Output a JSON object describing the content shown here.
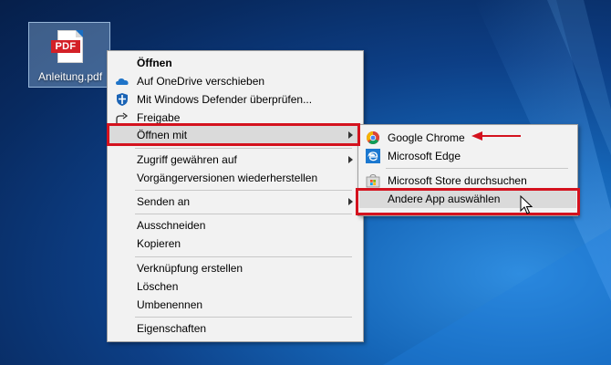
{
  "desktop": {
    "file_name": "Anleitung.pdf",
    "file_badge": "PDF"
  },
  "context_menu": {
    "items": [
      {
        "label": "Öffnen"
      },
      {
        "label": "Auf OneDrive verschieben",
        "icon": "onedrive-icon"
      },
      {
        "label": "Mit Windows Defender überprüfen...",
        "icon": "windows-defender-icon"
      },
      {
        "label": "Freigabe",
        "icon": "share-icon"
      },
      {
        "label": "Öffnen mit"
      },
      {
        "label": "Zugriff gewähren auf"
      },
      {
        "label": "Vorgängerversionen wiederherstellen"
      },
      {
        "label": "Senden an"
      },
      {
        "label": "Ausschneiden"
      },
      {
        "label": "Kopieren"
      },
      {
        "label": "Verknüpfung erstellen"
      },
      {
        "label": "Löschen"
      },
      {
        "label": "Umbenennen"
      },
      {
        "label": "Eigenschaften"
      }
    ]
  },
  "submenu": {
    "items": [
      {
        "label": "Google Chrome",
        "icon": "google-chrome-icon"
      },
      {
        "label": "Microsoft Edge",
        "icon": "microsoft-edge-icon"
      },
      {
        "label": "Microsoft Store durchsuchen",
        "icon": "microsoft-store-icon"
      },
      {
        "label": "Andere App auswählen"
      }
    ]
  },
  "colors": {
    "highlight_box": "#d4121e",
    "menu_background": "#f2f2f2",
    "hover_background": "#dadada"
  }
}
